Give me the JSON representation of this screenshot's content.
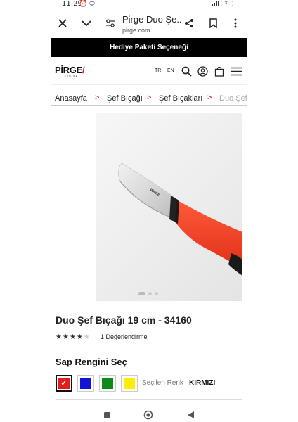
{
  "status_bar": {
    "time": "11:29",
    "left_icons": "⏰ ©",
    "battery": "31"
  },
  "browser": {
    "page_title": "Pirge Duo Şe...",
    "url": "pirge.com"
  },
  "announcement": "Hediye Paketi Seçeneği",
  "header": {
    "logo_text": "PİRGE",
    "logo_year": "• 1979 •",
    "lang_tr": "TR",
    "lang_en": "EN"
  },
  "breadcrumb": {
    "items": [
      "Anasayfa",
      "Şef Bıçağı",
      "Şef Bıçakları",
      "Duo Şef"
    ],
    "separator": ">"
  },
  "gallery": {
    "slide_count": 3,
    "active_index": 0,
    "blade_brand": "PİRGE"
  },
  "product": {
    "title": "Duo Şef Bıçağı 19 cm - 34160",
    "rating_value": 4,
    "rating_max": 5,
    "rating_count_label": "1 Değerlendirme"
  },
  "handle_color": {
    "section_title": "Sap Rengini Seç",
    "selected_label": "Seçilen Renk",
    "selected_value": "KIRMIZI",
    "options": [
      {
        "name": "red",
        "hex": "#e01e1e",
        "selected": true
      },
      {
        "name": "blue",
        "hex": "#1414d8",
        "selected": false
      },
      {
        "name": "green",
        "hex": "#0e8a1a",
        "selected": false
      },
      {
        "name": "yellow",
        "hex": "#ffee00",
        "selected": false
      }
    ]
  },
  "colors": {
    "accent_red": "#d81b1b",
    "announcement_bg": "#000000"
  }
}
